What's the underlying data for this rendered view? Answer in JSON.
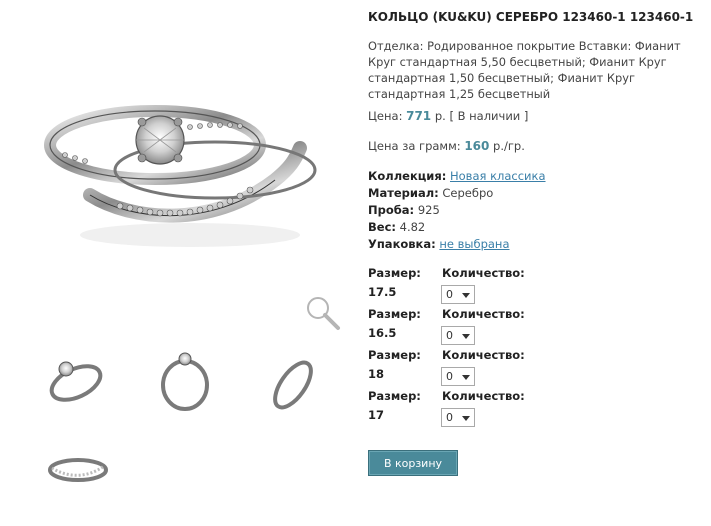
{
  "product": {
    "title": "КОЛЬЦО (KU&KU) СЕРЕБРО 123460-1 123460-1",
    "finish_label": "Отделка:",
    "finish_text": "Родированное покрытие Вставки: Фианит Круг стандартная 5,50 бесцветный; Фианит Круг стандартная 1,50 бесцветный; Фианит Круг стандартная 1,25 бесцветный",
    "price_label": "Цена:",
    "price_value": "771",
    "price_unit": "р.",
    "availability": "[ В наличии ]",
    "per_gram_label": "Цена за грамм:",
    "per_gram_value": "160",
    "per_gram_unit": "р./гр."
  },
  "props": {
    "collection_label": "Коллекция:",
    "collection_value": "Новая классика",
    "material_label": "Материал:",
    "material_value": "Серебро",
    "probe_label": "Проба:",
    "probe_value": "925",
    "weight_label": "Вес:",
    "weight_value": "4.82",
    "packaging_label": "Упаковка:",
    "packaging_value": "не выбрана"
  },
  "sizes": {
    "size_label": "Размер:",
    "qty_label": "Количество:",
    "rows": [
      {
        "size": "17.5",
        "qty": "0"
      },
      {
        "size": "16.5",
        "qty": "0"
      },
      {
        "size": "18",
        "qty": "0"
      },
      {
        "size": "17",
        "qty": "0"
      }
    ]
  },
  "cart_button": "В корзину",
  "icons": {
    "zoom": "magnifier-icon"
  }
}
